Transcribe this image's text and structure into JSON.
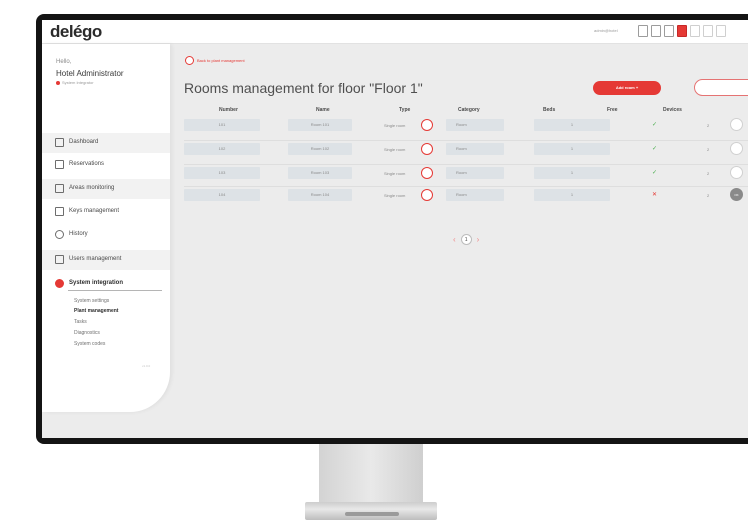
{
  "app": {
    "logo": "delégo"
  },
  "topbar": {
    "user": "admin@hotel"
  },
  "sidebar": {
    "greeting": "Hello,",
    "user_name": "Hotel Administrator",
    "user_role": "System Integrator",
    "items": [
      {
        "label": "Dashboard",
        "icon": "dashboard-icon"
      },
      {
        "label": "Reservations",
        "icon": "reservations-icon"
      },
      {
        "label": "Areas monitoring",
        "icon": "monitoring-icon"
      },
      {
        "label": "Keys management",
        "icon": "key-icon"
      },
      {
        "label": "History",
        "icon": "clock-icon"
      },
      {
        "label": "Users management",
        "icon": "users-icon"
      },
      {
        "label": "System integration",
        "icon": "integration-icon"
      }
    ],
    "subitems": [
      "System settings",
      "Plant management",
      "Tasks",
      "Diagnostics",
      "System codes"
    ],
    "active_subitem": "Plant management",
    "version": "v1.0.0"
  },
  "main": {
    "back_link": "Back to plant management",
    "title": "Rooms management for floor \"Floor 1\"",
    "add_room": "Add room +",
    "columns": [
      "Number",
      "Name",
      "Type",
      "Category",
      "Beds",
      "Free",
      "Devices"
    ],
    "rows": [
      {
        "number": "101",
        "name": "Room 101",
        "type": "Single room",
        "category": "Room",
        "beds": "1",
        "free": "✓",
        "free_ok": true,
        "devices": "2",
        "status": ""
      },
      {
        "number": "102",
        "name": "Room 102",
        "type": "Single room",
        "category": "Room",
        "beds": "1",
        "free": "✓",
        "free_ok": true,
        "devices": "2",
        "status": ""
      },
      {
        "number": "103",
        "name": "Room 103",
        "type": "Single room",
        "category": "Room",
        "beds": "1",
        "free": "✓",
        "free_ok": true,
        "devices": "2",
        "status": ""
      },
      {
        "number": "104",
        "name": "Room 104",
        "type": "Single room",
        "category": "Room",
        "beds": "1",
        "free": "✕",
        "free_ok": false,
        "devices": "2",
        "status": "OK"
      }
    ],
    "pagination": {
      "prev": "‹",
      "current": "1",
      "next": "›"
    }
  },
  "colors": {
    "accent": "#e53935",
    "ok": "#4caf50"
  }
}
